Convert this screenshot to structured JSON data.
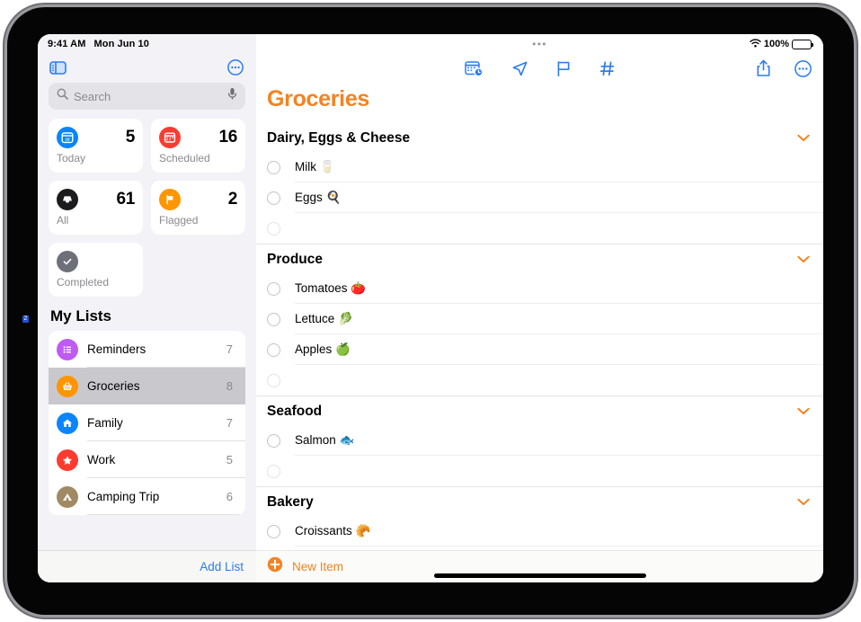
{
  "statusbar": {
    "time": "9:41 AM",
    "date": "Mon Jun 10",
    "battery_percent": "100%",
    "wifi_icon": "wifi-icon",
    "battery_icon": "battery-icon"
  },
  "sidebar": {
    "toggle_icon": "sidebar-toggle-icon",
    "more_icon": "more-options-icon",
    "search": {
      "placeholder": "Search",
      "search_icon": "search-icon",
      "mic_icon": "microphone-icon"
    },
    "smart_lists": [
      {
        "label": "Today",
        "count": "5",
        "icon": "calendar-today-icon",
        "color": "#0a84ff"
      },
      {
        "label": "Scheduled",
        "count": "16",
        "icon": "calendar-icon",
        "color": "#ff3b30"
      },
      {
        "label": "All",
        "count": "61",
        "icon": "all-inbox-icon",
        "color": "#1c1c1e"
      },
      {
        "label": "Flagged",
        "count": "2",
        "icon": "flag-icon",
        "color": "#ff9500"
      },
      {
        "label": "Completed",
        "count": "",
        "icon": "checkmark-circle-icon",
        "color": "#6e7079"
      }
    ],
    "my_lists_title": "My Lists",
    "lists": [
      {
        "label": "Reminders",
        "count": "7",
        "icon": "list-bullet-icon",
        "color": "#bf5af2",
        "selected": false
      },
      {
        "label": "Groceries",
        "count": "8",
        "icon": "basket-icon",
        "color": "#ff9500",
        "selected": true
      },
      {
        "label": "Family",
        "count": "7",
        "icon": "house-icon",
        "color": "#0a84ff",
        "selected": false
      },
      {
        "label": "Work",
        "count": "5",
        "icon": "star-icon",
        "color": "#ff3b30",
        "selected": false
      },
      {
        "label": "Camping Trip",
        "count": "6",
        "icon": "tent-icon",
        "color": "#a08a63",
        "selected": false
      }
    ],
    "add_list_label": "Add List"
  },
  "main": {
    "grabber_icon": "window-grabber-icon",
    "title": "Groceries",
    "title_color": "#f58220",
    "toolbar": [
      {
        "name": "date-time-icon",
        "label": "Date"
      },
      {
        "name": "location-icon",
        "label": "Location"
      },
      {
        "name": "flag-icon",
        "label": "Flag"
      },
      {
        "name": "tag-icon",
        "label": "Tag"
      }
    ],
    "toolbar_right": [
      {
        "name": "share-icon",
        "label": "Share"
      },
      {
        "name": "more-options-icon",
        "label": "More"
      }
    ],
    "groups": [
      {
        "title": "Dairy, Eggs & Cheese",
        "chevron_icon": "chevron-down-icon",
        "items": [
          {
            "text": "Milk 🥛",
            "empty": false
          },
          {
            "text": "Eggs 🍳",
            "empty": false
          },
          {
            "text": "",
            "empty": true
          }
        ]
      },
      {
        "title": "Produce",
        "chevron_icon": "chevron-down-icon",
        "items": [
          {
            "text": "Tomatoes 🍅",
            "empty": false
          },
          {
            "text": "Lettuce 🥬",
            "empty": false
          },
          {
            "text": "Apples 🍏",
            "empty": false
          },
          {
            "text": "",
            "empty": true
          }
        ]
      },
      {
        "title": "Seafood",
        "chevron_icon": "chevron-down-icon",
        "items": [
          {
            "text": "Salmon 🐟",
            "empty": false
          },
          {
            "text": "",
            "empty": true
          }
        ]
      },
      {
        "title": "Bakery",
        "chevron_icon": "chevron-down-icon",
        "items": [
          {
            "text": "Croissants 🥐",
            "empty": false
          }
        ]
      }
    ],
    "new_item_label": "New Item",
    "new_item_icon": "plus-circle-icon"
  }
}
